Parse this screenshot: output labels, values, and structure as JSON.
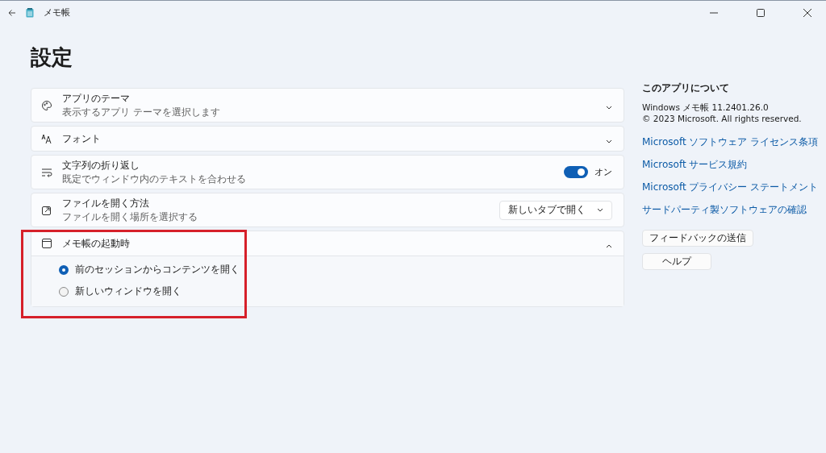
{
  "window": {
    "title": "メモ帳"
  },
  "page_title": "設定",
  "settings": [
    {
      "kind": "expander",
      "title": "アプリのテーマ",
      "description": "表示するアプリ テーマを選択します",
      "expanded": false
    },
    {
      "kind": "expander",
      "title": "フォント",
      "expanded": false
    },
    {
      "kind": "toggle",
      "title": "文字列の折り返し",
      "description": "既定でウィンドウ内のテキストを合わせる",
      "on": true,
      "state_label": "オン"
    },
    {
      "kind": "dropdown",
      "title": "ファイルを開く方法",
      "description": "ファイルを開く場所を選択する",
      "value": "新しいタブで開く"
    },
    {
      "kind": "radios",
      "title": "メモ帳の起動時",
      "expanded": true,
      "highlighted": true,
      "options": [
        {
          "label": "前のセッションからコンテンツを開く",
          "selected": true
        },
        {
          "label": "新しいウィンドウを開く",
          "selected": false
        }
      ]
    }
  ],
  "about": {
    "heading": "このアプリについて",
    "version": "Windows メモ帳 11.2401.26.0",
    "copyright": "© 2023 Microsoft. All rights reserved.",
    "links": [
      "Microsoft ソフトウェア ライセンス条項",
      "Microsoft サービス規約",
      "Microsoft プライバシー ステートメント",
      "サードパーティ製ソフトウェアの確認"
    ],
    "buttons": [
      "フィードバックの送信",
      "ヘルプ"
    ]
  }
}
